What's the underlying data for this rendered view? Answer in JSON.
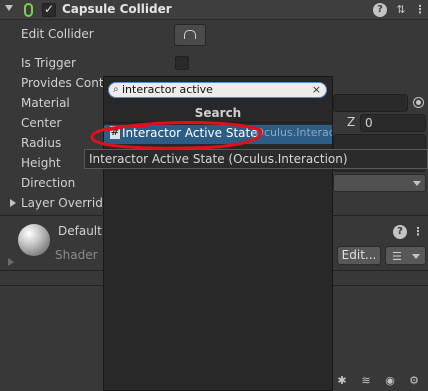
{
  "component": {
    "title": "Capsule Collider",
    "enabled": true,
    "help_icon": "help-icon",
    "preset_icon": "preset-sliders-icon",
    "menu_icon": "kebab-menu-icon"
  },
  "rows": {
    "edit_collider": "Edit Collider",
    "is_trigger": "Is Trigger",
    "provides_contacts": "Provides Conta",
    "material": "Material",
    "center": "Center",
    "radius": "Radius",
    "height": "Height",
    "direction": "Direction",
    "layer_overrides": "Layer Override"
  },
  "center_z": {
    "label": "Z",
    "value": "0"
  },
  "material_section": {
    "name": "Default",
    "shader_label": "Shader",
    "edit_button": "Edit..."
  },
  "search_popup": {
    "query": "interactor active",
    "header": "Search",
    "result_main": "Interactor Active State",
    "result_suffix": " (Oculus.Interac",
    "result_hash": "#",
    "tooltip": "Interactor Active State (Oculus.Interaction)"
  },
  "colors": {
    "background": "#383838",
    "selected_row": "#2c5d87",
    "annotation_red": "#e0101a"
  }
}
